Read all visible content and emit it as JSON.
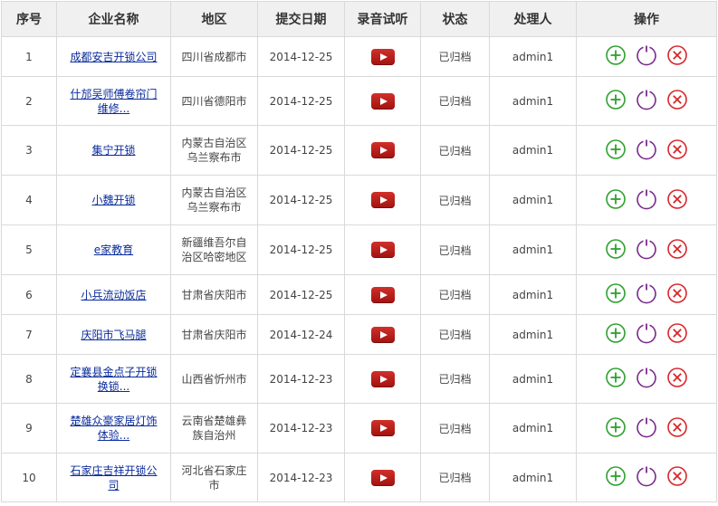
{
  "table": {
    "headers": [
      "序号",
      "企业名称",
      "地区",
      "提交日期",
      "录音试听",
      "状态",
      "处理人",
      "操作"
    ],
    "rows": [
      {
        "num": "1",
        "company": "成都安吉开锁公司",
        "region": "四川省成都市",
        "date": "2014-12-25",
        "status": "已归档",
        "handler": "admin1"
      },
      {
        "num": "2",
        "company": "什邡吴师傅卷帘门维修...",
        "region": "四川省德阳市",
        "date": "2014-12-25",
        "status": "已归档",
        "handler": "admin1"
      },
      {
        "num": "3",
        "company": "集宁开锁",
        "region": "内蒙古自治区乌兰察布市",
        "date": "2014-12-25",
        "status": "已归档",
        "handler": "admin1"
      },
      {
        "num": "4",
        "company": "小魏开锁",
        "region": "内蒙古自治区乌兰察布市",
        "date": "2014-12-25",
        "status": "已归档",
        "handler": "admin1"
      },
      {
        "num": "5",
        "company": "e家教育",
        "region": "新疆维吾尔自治区哈密地区",
        "date": "2014-12-25",
        "status": "已归档",
        "handler": "admin1"
      },
      {
        "num": "6",
        "company": "小兵流动饭店",
        "region": "甘肃省庆阳市",
        "date": "2014-12-25",
        "status": "已归档",
        "handler": "admin1"
      },
      {
        "num": "7",
        "company": "庆阳市飞马腿",
        "region": "甘肃省庆阳市",
        "date": "2014-12-24",
        "status": "已归档",
        "handler": "admin1"
      },
      {
        "num": "8",
        "company": "定襄县金点子开锁换锁...",
        "region": "山西省忻州市",
        "date": "2014-12-23",
        "status": "已归档",
        "handler": "admin1"
      },
      {
        "num": "9",
        "company": "楚雄众豪家居灯饰体验...",
        "region": "云南省楚雄彝族自治州",
        "date": "2014-12-23",
        "status": "已归档",
        "handler": "admin1"
      },
      {
        "num": "10",
        "company": "石家庄吉祥开锁公司",
        "region": "河北省石家庄市",
        "date": "2014-12-23",
        "status": "已归档",
        "handler": "admin1"
      }
    ]
  },
  "icons": {
    "play": "play-icon",
    "add": "add-circle-icon",
    "reset": "reset-circle-icon",
    "delete": "delete-circle-icon"
  },
  "colors": {
    "add": "#2ea02e",
    "reset": "#7a2b8c",
    "delete": "#d9262a",
    "play": "#b3201a",
    "link": "#0b2c9c",
    "header_bg": "#f0f0f0",
    "border": "#d9d9d9"
  }
}
